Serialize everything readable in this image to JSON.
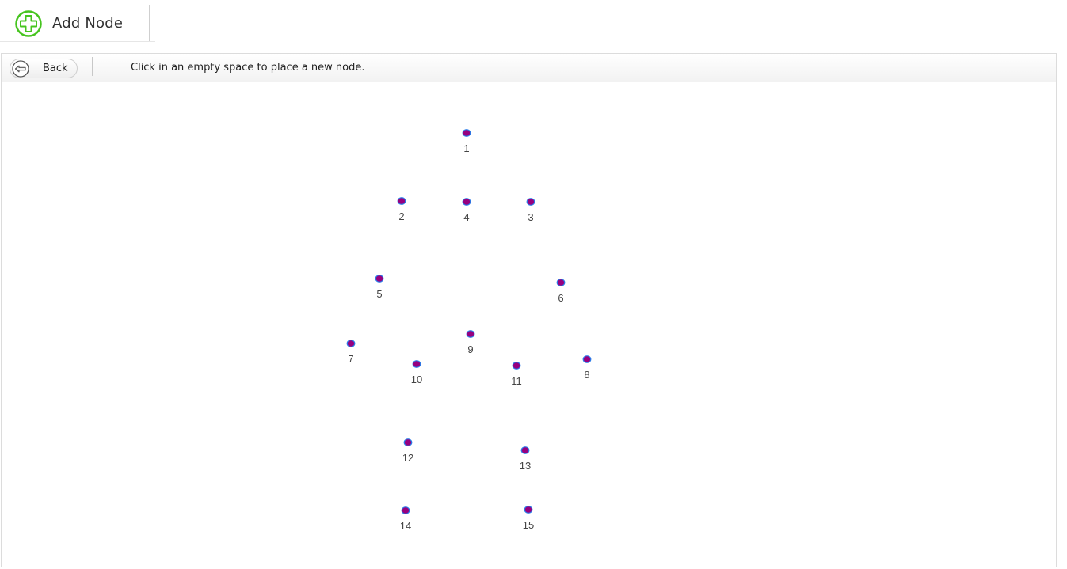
{
  "toolbar": {
    "add_node_label": "Add Node",
    "add_node_icon": "plus-circle-icon",
    "accent_color": "#46c41f"
  },
  "manipulation": {
    "back_label": "Back",
    "back_icon": "back-arrow-icon",
    "instruction": "Click in an empty space to place a new node."
  },
  "network": {
    "node_color": "#97007f",
    "node_border_color": "#2b7ce9",
    "nodes": [
      {
        "id": 1,
        "label": "1"
      },
      {
        "id": 2,
        "label": "2"
      },
      {
        "id": 3,
        "label": "3"
      },
      {
        "id": 4,
        "label": "4"
      },
      {
        "id": 5,
        "label": "5"
      },
      {
        "id": 6,
        "label": "6"
      },
      {
        "id": 7,
        "label": "7"
      },
      {
        "id": 8,
        "label": "8"
      },
      {
        "id": 9,
        "label": "9"
      },
      {
        "id": 10,
        "label": "10"
      },
      {
        "id": 11,
        "label": "11"
      },
      {
        "id": 12,
        "label": "12"
      },
      {
        "id": 13,
        "label": "13"
      },
      {
        "id": 14,
        "label": "14"
      },
      {
        "id": 15,
        "label": "15"
      }
    ]
  }
}
